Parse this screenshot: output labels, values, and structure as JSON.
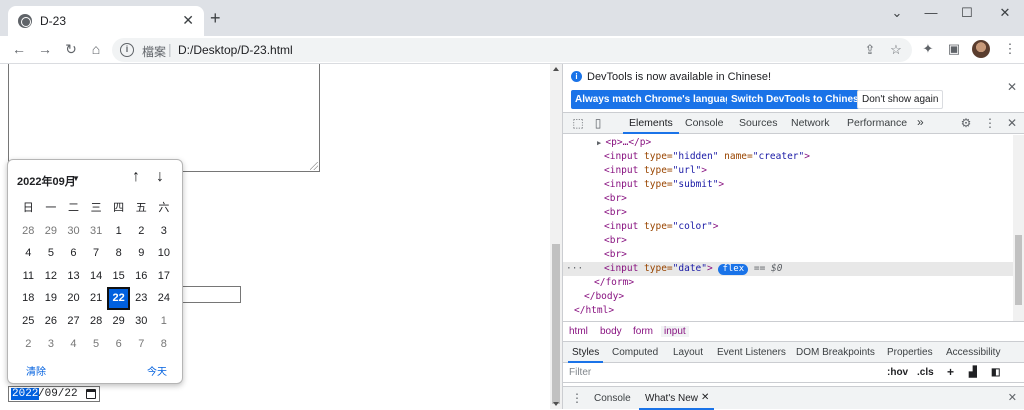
{
  "browser": {
    "tab_title": "D-23",
    "tab_close": "✕",
    "new_tab": "+",
    "min": "—",
    "max": "☐",
    "close": "✕",
    "url_scheme": "檔案",
    "url_sep": "|",
    "url": "D:/Desktop/D-23.html",
    "info_icon": "i"
  },
  "picker": {
    "month_label": "2022年09月",
    "caret": "▼",
    "up": "↑",
    "down": "↓",
    "weekdays": [
      "日",
      "一",
      "二",
      "三",
      "四",
      "五",
      "六"
    ],
    "rows": [
      [
        "28",
        "29",
        "30",
        "31",
        "1",
        "2",
        "3"
      ],
      [
        "4",
        "5",
        "6",
        "7",
        "8",
        "9",
        "10"
      ],
      [
        "11",
        "12",
        "13",
        "14",
        "15",
        "16",
        "17"
      ],
      [
        "18",
        "19",
        "20",
        "21",
        "22",
        "23",
        "24"
      ],
      [
        "25",
        "26",
        "27",
        "28",
        "29",
        "30",
        "1"
      ],
      [
        "2",
        "3",
        "4",
        "5",
        "6",
        "7",
        "8"
      ]
    ],
    "selected": "22",
    "clear_label": "清除",
    "today_label": "今天"
  },
  "date_input": {
    "year": "2022",
    "rest": "/09/22"
  },
  "devtools": {
    "banner_message": "DevTools is now available in Chinese!",
    "banner_info": "i",
    "banner_close": "✕",
    "btn_match": "Always match Chrome's language",
    "btn_switch": "Switch DevTools to Chinese",
    "btn_dont": "Don't show again",
    "tabs": {
      "elements": "Elements",
      "console": "Console",
      "sources": "Sources",
      "network": "Network",
      "performance": "Performance",
      "more": "»"
    },
    "lines": {
      "p": "<p>…</p>",
      "hidden_a": "<input ",
      "hidden_ta": "type=",
      "hidden_tv": "\"hidden\"",
      "hidden_na": " name=",
      "hidden_nv": "\"creater\"",
      "url_a": "<input ",
      "url_ta": "type=",
      "url_tv": "\"url\"",
      "submit_a": "<input ",
      "submit_ta": "type=",
      "submit_tv": "\"submit\"",
      "br": "<br>",
      "color_a": "<input ",
      "color_ta": "type=",
      "color_tv": "\"color\"",
      "date_a": "<input ",
      "date_ta": "type=",
      "date_tv": "\"date\"",
      "close_gt": ">",
      "flex": "flex",
      "eq": "== $0",
      "form_close": "</form>",
      "body_close": "</body>",
      "html_close": "</html>",
      "ellipsis": "···"
    },
    "breadcrumbs": [
      "html",
      "body",
      "form",
      "input"
    ],
    "pane_tabs": [
      "Styles",
      "Computed",
      "Layout",
      "Event Listeners",
      "DOM Breakpoints",
      "Properties",
      "Accessibility"
    ],
    "filter_placeholder": "Filter",
    "hov": ":hov",
    "cls": ".cls",
    "plus": "+",
    "drawer_console": "Console",
    "drawer_whatsnew": "What's New",
    "drawer_x": "✕"
  },
  "colors": {
    "accent": "#1a73e8",
    "picker_selected": "#0060df"
  }
}
